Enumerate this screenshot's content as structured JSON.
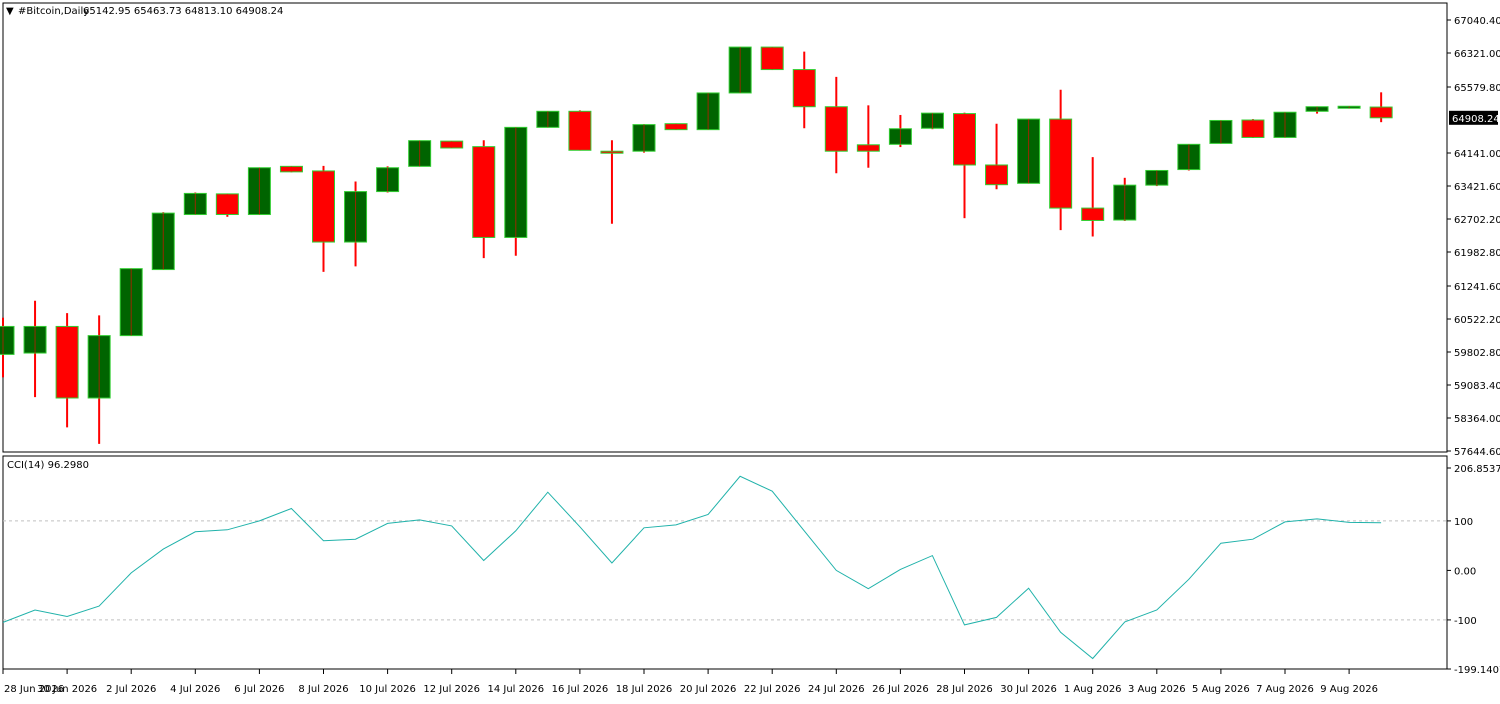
{
  "header": {
    "symbol_label": "#Bitcoin,Daily",
    "ohlc_label": "65142.95 65463.73 64813.10 64908.24"
  },
  "cci_panel": {
    "label": "CCI(14) 96.2980",
    "axis_labels": [
      "206.8537",
      "100",
      "0.00",
      "-100",
      "-199.1407"
    ]
  },
  "price_axis_labels": [
    "67040.40",
    "66321.00",
    "65579.80",
    "64908.24",
    "64141.00",
    "63421.60",
    "62702.20",
    "61982.80",
    "61241.60",
    "60522.20",
    "59802.80",
    "59083.40",
    "58364.00",
    "57644.60"
  ],
  "colors": {
    "bull_body": "#006400",
    "bear_body": "#ff0000",
    "wick": "#ff0000",
    "body_outline": "#32cd32",
    "cci_line": "#20b2aa",
    "level_line": "#c0c0c0",
    "current_price_bg": "#000000"
  },
  "chart_data": [
    {
      "type": "candlestick",
      "title": "#Bitcoin,Daily",
      "x_tick_labels": [
        "28 Jun 2026",
        "30 Jun 2026",
        "2 Jul 2026",
        "4 Jul 2026",
        "6 Jul 2026",
        "8 Jul 2026",
        "10 Jul 2026",
        "12 Jul 2026",
        "14 Jul 2026",
        "16 Jul 2026",
        "18 Jul 2026",
        "20 Jul 2026",
        "22 Jul 2026",
        "24 Jul 2026",
        "26 Jul 2026",
        "28 Jul 2026",
        "30 Jul 2026",
        "1 Aug 2026",
        "3 Aug 2026",
        "5 Aug 2026",
        "7 Aug 2026",
        "9 Aug 2026"
      ],
      "ylim": [
        57644.6,
        67040.4
      ],
      "current_price": 64908.24,
      "grid": false,
      "candles": [
        {
          "open": 59750,
          "high": 60550,
          "low": 59250,
          "close": 60360
        },
        {
          "open": 59780,
          "high": 60920,
          "low": 58820,
          "close": 60360
        },
        {
          "open": 60360,
          "high": 60650,
          "low": 58160,
          "close": 58800
        },
        {
          "open": 58800,
          "high": 60600,
          "low": 57800,
          "close": 60160
        },
        {
          "open": 60160,
          "high": 61600,
          "low": 60160,
          "close": 61620
        },
        {
          "open": 61600,
          "high": 62850,
          "low": 61620,
          "close": 62830
        },
        {
          "open": 62800,
          "high": 63280,
          "low": 62850,
          "close": 63260
        },
        {
          "open": 63250,
          "high": 63250,
          "low": 62750,
          "close": 62800
        },
        {
          "open": 62800,
          "high": 63820,
          "low": 62800,
          "close": 63820
        },
        {
          "open": 63850,
          "high": 63850,
          "low": 63720,
          "close": 63730
        },
        {
          "open": 63750,
          "high": 63860,
          "low": 61550,
          "close": 62200
        },
        {
          "open": 62200,
          "high": 63520,
          "low": 61670,
          "close": 63300
        },
        {
          "open": 63300,
          "high": 63850,
          "low": 63280,
          "close": 63820
        },
        {
          "open": 63850,
          "high": 64410,
          "low": 63850,
          "close": 64410
        },
        {
          "open": 64400,
          "high": 64400,
          "low": 64250,
          "close": 64250
        },
        {
          "open": 64280,
          "high": 64420,
          "low": 61850,
          "close": 62300
        },
        {
          "open": 62300,
          "high": 64700,
          "low": 61900,
          "close": 64700
        },
        {
          "open": 64700,
          "high": 65050,
          "low": 64700,
          "close": 65050
        },
        {
          "open": 65050,
          "high": 65070,
          "low": 64200,
          "close": 64200
        },
        {
          "open": 64180,
          "high": 64420,
          "low": 62600,
          "close": 64150
        },
        {
          "open": 64180,
          "high": 64770,
          "low": 64150,
          "close": 64760
        },
        {
          "open": 64780,
          "high": 64780,
          "low": 64650,
          "close": 64650
        },
        {
          "open": 64650,
          "high": 65450,
          "low": 64650,
          "close": 65450
        },
        {
          "open": 65450,
          "high": 66450,
          "low": 65450,
          "close": 66450
        },
        {
          "open": 66450,
          "high": 66450,
          "low": 65950,
          "close": 65960
        },
        {
          "open": 65960,
          "high": 66350,
          "low": 64680,
          "close": 65150
        },
        {
          "open": 65150,
          "high": 65800,
          "low": 63700,
          "close": 64180
        },
        {
          "open": 64320,
          "high": 65180,
          "low": 63820,
          "close": 64180
        },
        {
          "open": 64330,
          "high": 64970,
          "low": 64270,
          "close": 64670
        },
        {
          "open": 64680,
          "high": 65010,
          "low": 64660,
          "close": 65010
        },
        {
          "open": 65000,
          "high": 65020,
          "low": 62720,
          "close": 63880
        },
        {
          "open": 63880,
          "high": 64780,
          "low": 63350,
          "close": 63450
        },
        {
          "open": 63480,
          "high": 64870,
          "low": 63480,
          "close": 64880
        },
        {
          "open": 64880,
          "high": 65520,
          "low": 62460,
          "close": 62940
        },
        {
          "open": 62940,
          "high": 64050,
          "low": 62320,
          "close": 62670
        },
        {
          "open": 62680,
          "high": 63600,
          "low": 62660,
          "close": 63440
        },
        {
          "open": 63440,
          "high": 63770,
          "low": 63420,
          "close": 63760
        },
        {
          "open": 63780,
          "high": 64330,
          "low": 63760,
          "close": 64330
        },
        {
          "open": 64350,
          "high": 64850,
          "low": 64350,
          "close": 64850
        },
        {
          "open": 64860,
          "high": 64880,
          "low": 64470,
          "close": 64480
        },
        {
          "open": 64480,
          "high": 65030,
          "low": 64480,
          "close": 65030
        },
        {
          "open": 65050,
          "high": 65150,
          "low": 65000,
          "close": 65150
        },
        {
          "open": 65150,
          "high": 65160,
          "low": 65130,
          "close": 65160
        },
        {
          "open": 65142.95,
          "high": 65463.73,
          "low": 64813.1,
          "close": 64908.24
        }
      ]
    },
    {
      "type": "line",
      "title": "CCI(14) 96.2980",
      "ylim": [
        -199.1407,
        206.8537
      ],
      "levels": [
        100,
        0,
        -100
      ],
      "series": [
        {
          "name": "CCI(14)",
          "values": [
            -105,
            -80,
            -93,
            -72,
            -5,
            43,
            78,
            82,
            100,
            125,
            60,
            63,
            95,
            102,
            90,
            20,
            80,
            158,
            88,
            15,
            86,
            92,
            113,
            190,
            160,
            80,
            0,
            -37,
            2,
            30,
            -110,
            -95,
            -36,
            -125,
            -178,
            -104,
            -80,
            -18,
            55,
            63,
            98,
            104,
            97,
            96.3
          ]
        }
      ]
    }
  ]
}
